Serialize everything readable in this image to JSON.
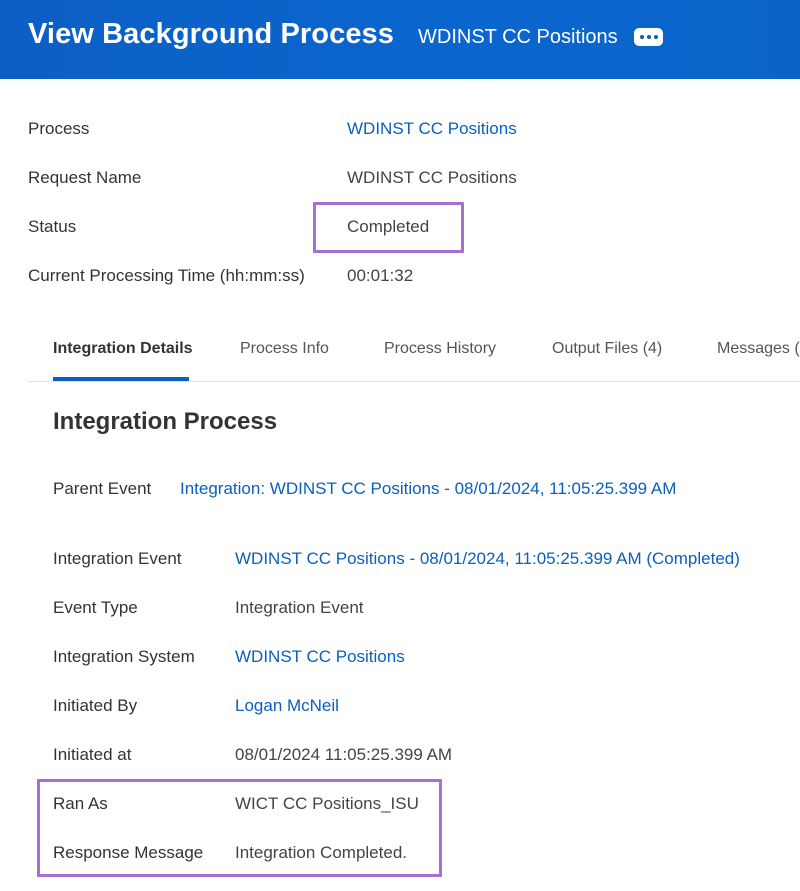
{
  "header": {
    "title": "View Background Process",
    "subtitle": "WDINST CC Positions",
    "more_icon": "ellipsis-icon"
  },
  "summary": {
    "process_label": "Process",
    "process_value": "WDINST CC Positions",
    "request_name_label": "Request Name",
    "request_name_value": "WDINST CC Positions",
    "status_label": "Status",
    "status_value": "Completed",
    "time_label": "Current Processing Time (hh:mm:ss)",
    "time_value": "00:01:32"
  },
  "tabs": [
    {
      "label": "Integration Details",
      "active": true
    },
    {
      "label": "Process Info"
    },
    {
      "label": "Process History"
    },
    {
      "label": "Output Files (4)"
    },
    {
      "label": "Messages ("
    }
  ],
  "integration": {
    "section_title": "Integration Process",
    "parent_event_label": "Parent Event",
    "parent_event_value": "Integration: WDINST CC Positions - 08/01/2024, 11:05:25.399 AM",
    "integration_event_label": "Integration Event",
    "integration_event_value": "WDINST CC Positions - 08/01/2024, 11:05:25.399 AM (Completed)",
    "event_type_label": "Event Type",
    "event_type_value": "Integration Event",
    "integration_system_label": "Integration System",
    "integration_system_value": "WDINST CC Positions",
    "initiated_by_label": "Initiated By",
    "initiated_by_value": "Logan McNeil",
    "initiated_at_label": "Initiated at",
    "initiated_at_value": "08/01/2024 11:05:25.399 AM",
    "ran_as_label": "Ran As",
    "ran_as_value": "WICT CC Positions_ISU",
    "response_message_label": "Response Message",
    "response_message_value": "Integration Completed."
  },
  "colors": {
    "header_bg": "#0b63c8",
    "link": "#0a5fbf",
    "highlight": "#a66fd3"
  }
}
